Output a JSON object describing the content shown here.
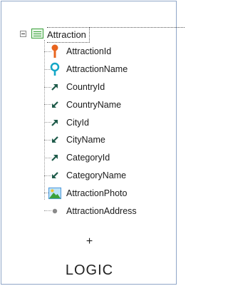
{
  "tree": {
    "root": {
      "label": "Attraction",
      "icon": "transaction-table-icon",
      "expanded": true
    },
    "items": [
      {
        "label": "AttractionId",
        "icon": "primary-key-icon",
        "color": "#e8641e"
      },
      {
        "label": "AttractionName",
        "icon": "description-attribute-icon",
        "color": "#14a7c7"
      },
      {
        "label": "CountryId",
        "icon": "foreign-key-icon",
        "color": "#1f5b4a"
      },
      {
        "label": "CountryName",
        "icon": "inferred-attribute-icon",
        "color": "#1f5b4a"
      },
      {
        "label": "CityId",
        "icon": "foreign-key-icon",
        "color": "#1f5b4a"
      },
      {
        "label": "CityName",
        "icon": "inferred-attribute-icon",
        "color": "#1f5b4a"
      },
      {
        "label": "CategoryId",
        "icon": "foreign-key-icon",
        "color": "#1f5b4a"
      },
      {
        "label": "CategoryName",
        "icon": "inferred-attribute-icon",
        "color": "#1f5b4a"
      },
      {
        "label": "AttractionPhoto",
        "icon": "image-attribute-icon",
        "color": "#3f8fd8"
      },
      {
        "label": "AttractionAddress",
        "icon": "attribute-dot-icon",
        "color": "#8a8a8a"
      }
    ]
  },
  "footer": {
    "plus": "+",
    "logic": "LOGIC"
  }
}
